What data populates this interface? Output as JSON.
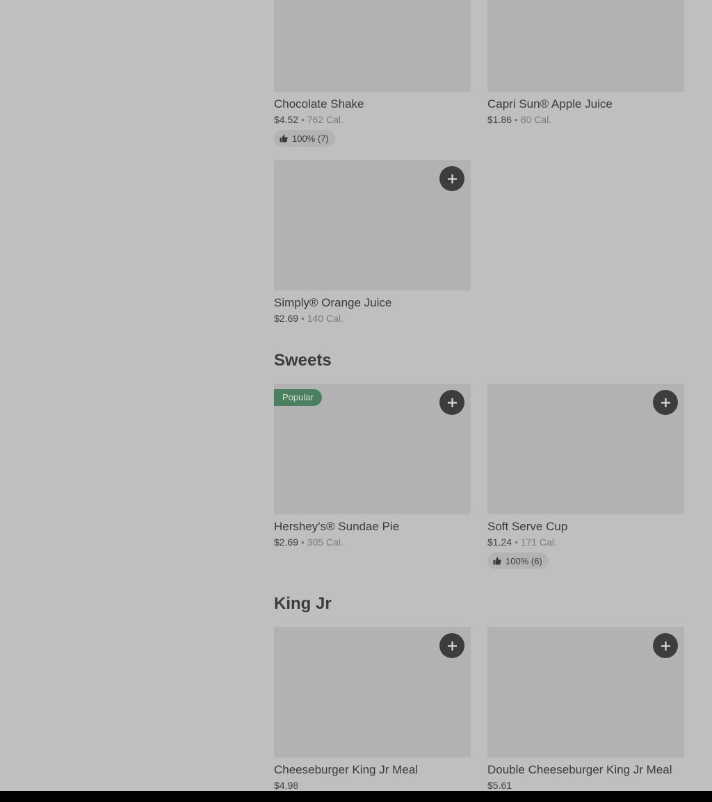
{
  "colors": {
    "page_background": "#bfbfbf",
    "image_placeholder": "#b2b2b2",
    "add_button": "#3d3d3d",
    "popular_badge": "#4b7f5f",
    "bottom_bar": "#000000"
  },
  "icons": {
    "add": "plus-icon",
    "rating": "thumbs-up-icon"
  },
  "drinks": {
    "items": [
      {
        "name": "Chocolate Shake",
        "price": "$4.52",
        "sep": "•",
        "calories": "762 Cal.",
        "rating": "100% (7)"
      },
      {
        "name": "Capri Sun® Apple Juice",
        "price": "$1.86",
        "sep": "•",
        "calories": "80 Cal."
      },
      {
        "name": "Simply® Orange Juice",
        "price": "$2.69",
        "sep": "•",
        "calories": "140 Cal."
      }
    ]
  },
  "sweets": {
    "title": "Sweets",
    "items": [
      {
        "name": "Hershey's® Sundae Pie",
        "price": "$2.69",
        "sep": "•",
        "calories": "305 Cal.",
        "badge": "Popular"
      },
      {
        "name": "Soft Serve Cup",
        "price": "$1.24",
        "sep": "•",
        "calories": "171 Cal.",
        "rating": "100% (6)"
      }
    ]
  },
  "king_jr": {
    "title": "King Jr",
    "items": [
      {
        "name": "Cheeseburger King Jr Meal",
        "price": "$4.98"
      },
      {
        "name": "Double Cheeseburger King Jr Meal",
        "price": "$5.61"
      }
    ]
  }
}
